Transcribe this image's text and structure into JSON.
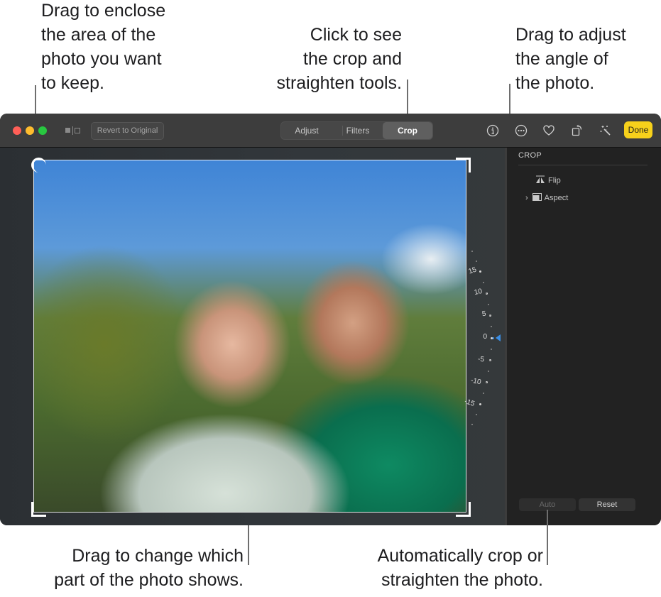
{
  "callouts": {
    "crop_area": [
      "Drag to enclose",
      "the area of the",
      "photo you want",
      "to keep."
    ],
    "crop_tab": [
      "Click to see",
      "the crop and",
      "straighten tools."
    ],
    "angle": [
      "Drag to adjust",
      "the angle of",
      "the photo."
    ],
    "move_photo": [
      "Drag to change which",
      "part of the photo shows."
    ],
    "auto": [
      "Automatically crop or",
      "straighten the photo."
    ]
  },
  "toolbar": {
    "revert_label": "Revert to Original",
    "tabs": [
      {
        "label": "Adjust",
        "selected": false
      },
      {
        "label": "Filters",
        "selected": false
      },
      {
        "label": "Crop",
        "selected": true
      }
    ],
    "icons": [
      "info-icon",
      "more-icon",
      "heart-icon",
      "rotate-icon",
      "auto-enhance-icon"
    ],
    "done_label": "Done",
    "done_color": "#f7d11b"
  },
  "dial": {
    "labels": [
      "15",
      "10",
      "5",
      "0",
      "-5",
      "-10",
      "-15"
    ],
    "current_angle": 0,
    "pointer_color": "#3a8ee6"
  },
  "sidebar": {
    "section_title": "CROP",
    "items": [
      {
        "label": "Flip",
        "icon": "flip-icon"
      },
      {
        "label": "Aspect",
        "icon": "aspect-icon",
        "expandable": true
      }
    ],
    "auto_label": "Auto",
    "reset_label": "Reset"
  }
}
